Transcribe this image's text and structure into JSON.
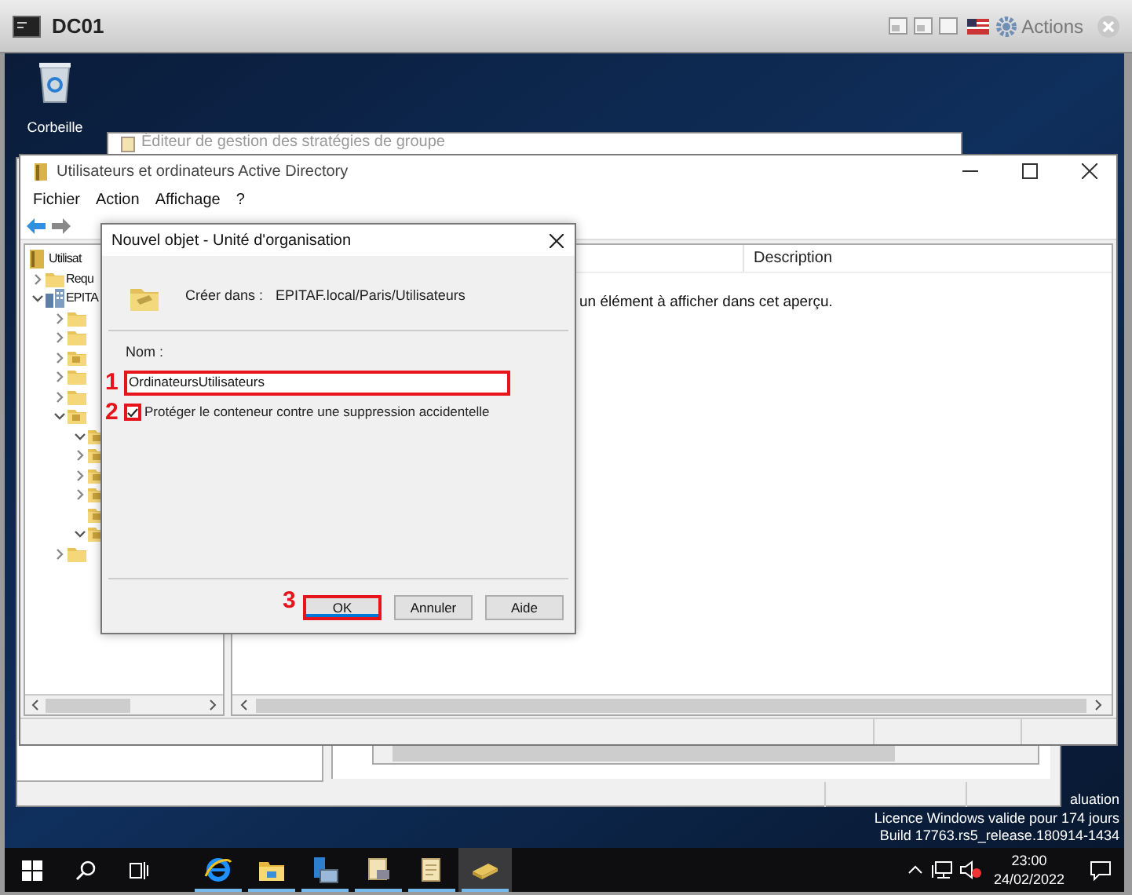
{
  "vm_bar": {
    "title": "DC01",
    "actions": "Actions"
  },
  "desktop_icons": [
    {
      "label": "Corbeille"
    }
  ],
  "back_window": {
    "title": "Éditeur de gestion des stratégies de groupe"
  },
  "ad_window": {
    "title": "Utilisateurs et ordinateurs Active Directory",
    "menu": [
      "Fichier",
      "Action",
      "Affichage",
      "?"
    ],
    "tree": [
      {
        "label": "Utilisat",
        "kind": "book"
      },
      {
        "label": "Requ",
        "kind": "folder",
        "expanded": false
      },
      {
        "label": "EPITA",
        "kind": "domain",
        "expanded": true,
        "children": [
          {
            "kind": "folder",
            "expanded": false
          },
          {
            "kind": "folder",
            "expanded": false
          },
          {
            "kind": "ou",
            "expanded": false
          },
          {
            "kind": "folder",
            "expanded": false
          },
          {
            "kind": "folder",
            "expanded": false
          },
          {
            "kind": "ou",
            "expanded": true,
            "children": [
              {
                "kind": "ou",
                "expanded": true
              },
              {
                "kind": "ou",
                "expanded": false
              },
              {
                "kind": "ou",
                "expanded": false
              },
              {
                "kind": "ou",
                "expanded": false
              },
              {
                "kind": "ou"
              },
              {
                "kind": "ou",
                "expanded": true
              }
            ]
          },
          {
            "kind": "folder",
            "expanded": false
          }
        ]
      }
    ],
    "columns": [
      "Description"
    ],
    "message": "un élément à afficher dans cet aperçu."
  },
  "dialog": {
    "title": "Nouvel objet - Unité d'organisation",
    "create_in_label": "Créer dans :",
    "create_in_value": "EPITAF.local/Paris/Utilisateurs",
    "name_label": "Nom :",
    "name_field": {
      "value": "OrdinateursUtilisateurs",
      "annotation": "1"
    },
    "protect": {
      "label": "Protéger le conteneur contre une suppression accidentelle",
      "checked": true,
      "annotation": "2"
    },
    "buttons": [
      {
        "label": "OK",
        "default": true,
        "annotation": "3"
      },
      {
        "label": "Annuler",
        "default": false
      },
      {
        "label": "Aide",
        "default": false
      }
    ]
  },
  "watermark_lines": [
    "aluation",
    "Licence Windows valide pour 174 jours",
    "Build 17763.rs5_release.180914-1434"
  ],
  "taskbar": {
    "apps": [
      {
        "kind": "start"
      },
      {
        "kind": "search"
      },
      {
        "kind": "taskview"
      },
      {
        "kind": "browser",
        "running": true,
        "selected": false
      },
      {
        "kind": "explorer",
        "running": true,
        "selected": false
      },
      {
        "kind": "server",
        "running": true,
        "selected": false
      },
      {
        "kind": "scroll",
        "running": true,
        "selected": false
      },
      {
        "kind": "scroll2",
        "running": true,
        "selected": false
      },
      {
        "kind": "book",
        "running": true,
        "selected": true
      }
    ],
    "time": "23:00",
    "date": "24/02/2022"
  }
}
